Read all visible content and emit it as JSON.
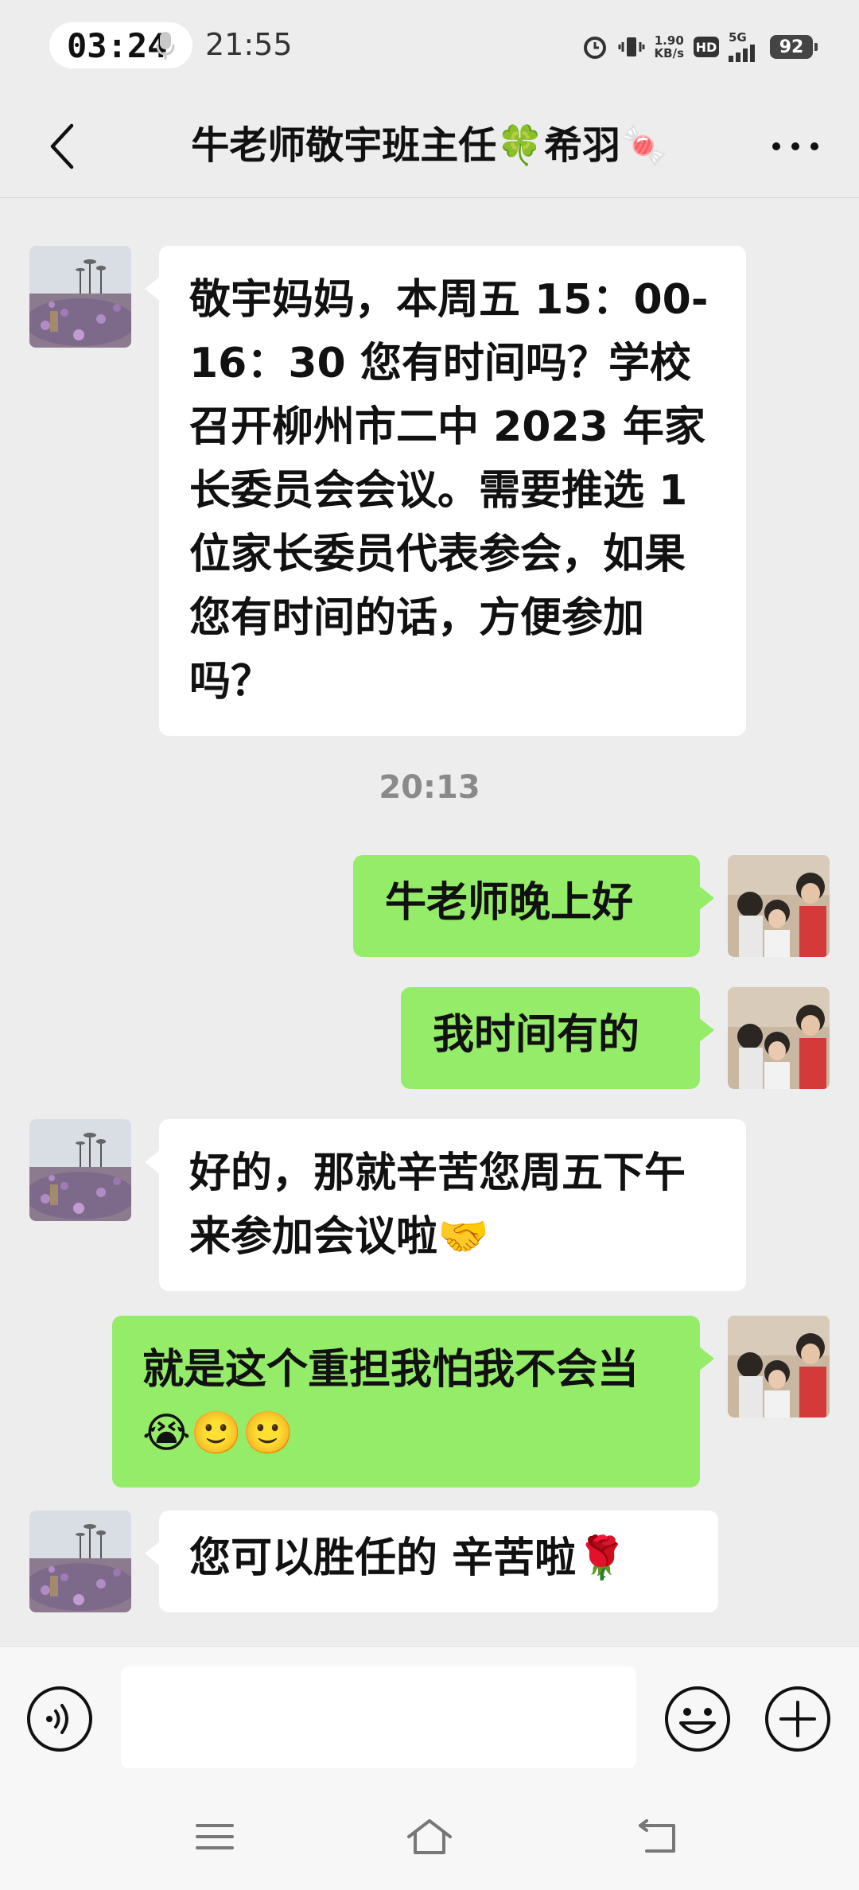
{
  "status_bar": {
    "call_timer": "03:24",
    "clock": "21:55",
    "net_speed_value": "1.90",
    "net_speed_unit": "KB/s",
    "hd_label": "HD",
    "network_type": "5G",
    "battery": "92"
  },
  "header": {
    "title": "牛老师敬宇班主任🍀希羽🍬"
  },
  "messages": [
    {
      "side": "in",
      "text": "敬宇妈妈，本周五 15：00-16：30 您有时间吗？学校召开柳州市二中 2023 年家长委员会会议。需要推选 1 位家长委员代表参会，如果您有时间的话，方便参加吗？"
    },
    {
      "side": "time",
      "text": "20:13"
    },
    {
      "side": "out",
      "text": "牛老师晚上好"
    },
    {
      "side": "out",
      "text": "我时间有的"
    },
    {
      "side": "in",
      "text": "好的，那就辛苦您周五下午来参加会议啦🤝"
    },
    {
      "side": "out",
      "text": "就是这个重担我怕我不会当😭🙂🙂"
    },
    {
      "side": "in",
      "text": "您可以胜任的 辛苦啦🌹"
    }
  ],
  "icons": {
    "back": "chevron-left-icon",
    "more": "more-icon",
    "voice": "voice-icon",
    "emoji": "smiley-icon",
    "plus": "plus-icon",
    "nav_menu": "menu-icon",
    "nav_home": "home-icon",
    "nav_back": "back-nav-icon"
  },
  "colors": {
    "background": "#ededed",
    "bubble_in": "#ffffff",
    "bubble_out": "#95ec69",
    "timestamp": "#8a8a8a"
  }
}
